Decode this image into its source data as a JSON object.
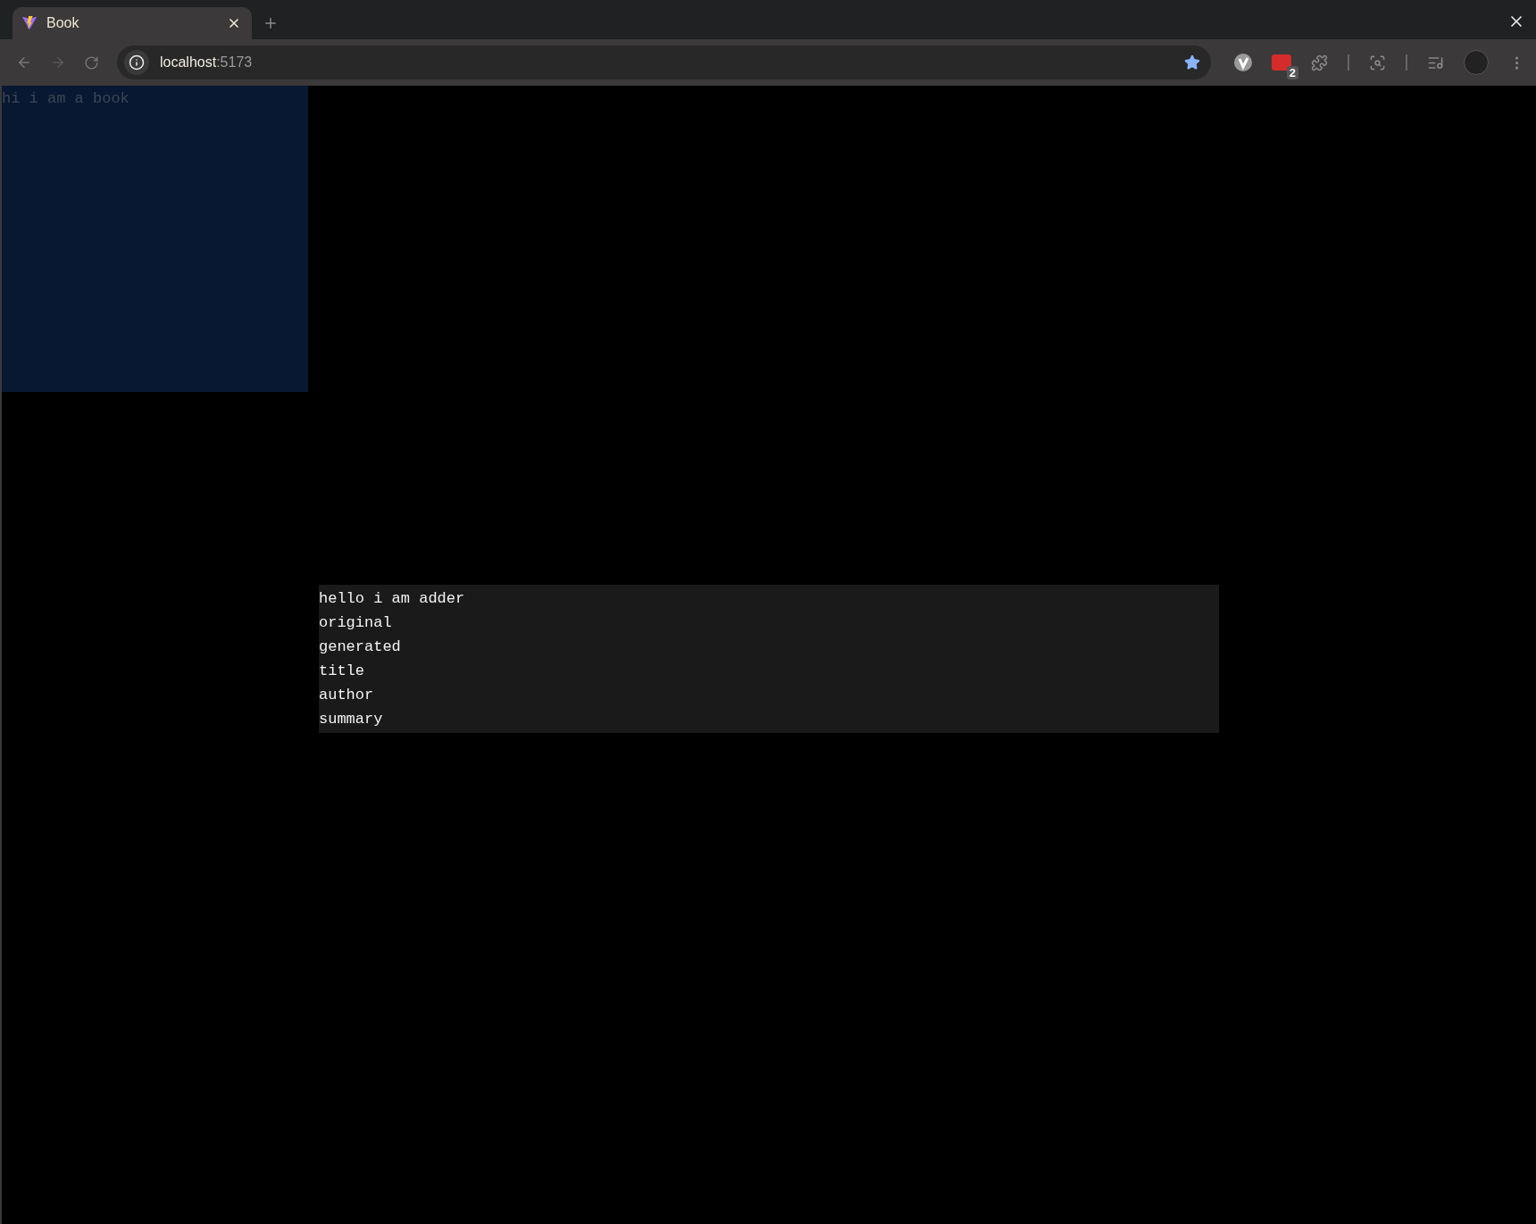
{
  "browser": {
    "tabs": [
      {
        "title": "Book",
        "selected": true
      }
    ],
    "address": {
      "host": "localhost",
      "rest": ":5173"
    },
    "bookmarked": true,
    "extension_badge": "2"
  },
  "book": {
    "text": "hi i am a book"
  },
  "adder": {
    "lines": [
      "hello i am adder",
      "original",
      "generated",
      "title",
      "author",
      "summary"
    ]
  }
}
